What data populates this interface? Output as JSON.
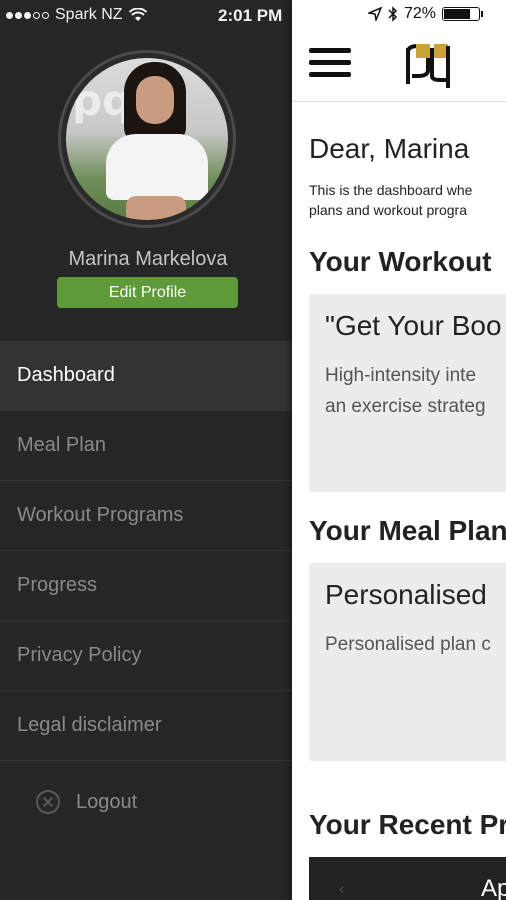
{
  "status_bar": {
    "carrier": "Spark NZ",
    "time": "2:01 PM",
    "battery": "72%"
  },
  "drawer": {
    "user_name": "Marina Markelova",
    "edit_profile_label": "Edit Profile",
    "menu_items": [
      {
        "label": "Dashboard",
        "active": true
      },
      {
        "label": "Meal Plan",
        "active": false
      },
      {
        "label": "Workout Programs",
        "active": false
      },
      {
        "label": "Progress",
        "active": false
      },
      {
        "label": "Privacy Policy",
        "active": false
      },
      {
        "label": "Legal disclaimer",
        "active": false
      }
    ],
    "logout_label": "Logout"
  },
  "main": {
    "greeting": "Dear, Marina",
    "intro_line1": "This is the dashboard whe",
    "intro_line2": "plans and workout progra",
    "workout_section_title": "Your Workout",
    "workout_card_title": "\"Get Your Boo",
    "workout_card_line1": "High-intensity inte",
    "workout_card_line2": "an exercise strateg",
    "meal_section_title": "Your Meal Plan",
    "meal_card_title": "Personalised",
    "meal_card_line1": "Personalised plan c",
    "progress_section_title": "Your Recent Pr",
    "progress_box_text": "Ap"
  },
  "colors": {
    "drawer_bg": "#262626",
    "accent_green": "#5e9a3a",
    "logo_gold": "#c9a23a"
  }
}
